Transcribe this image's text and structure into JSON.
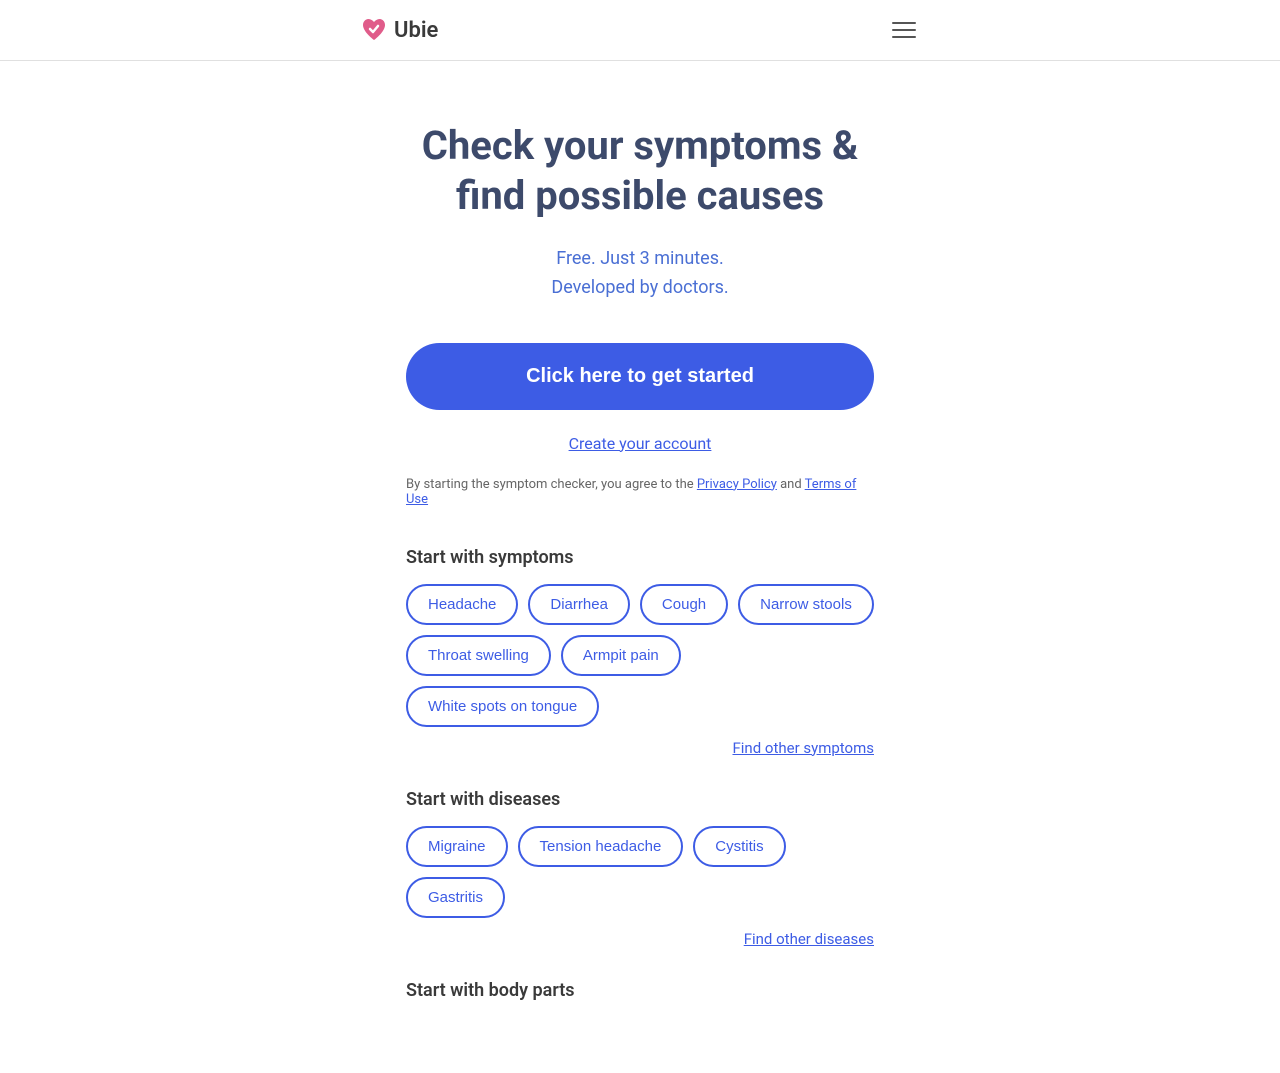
{
  "header": {
    "logo_text": "Ubie",
    "menu_label": "Menu"
  },
  "hero": {
    "title_line1": "Check your symptoms &",
    "title_line2": "find possible causes",
    "subtitle_line1": "Free. Just 3 minutes.",
    "subtitle_line2": "Developed by doctors."
  },
  "cta": {
    "button_label": "Click here to get started",
    "create_account_label": "Create your account",
    "terms_prefix": "By starting the symptom checker, you agree to the ",
    "terms_privacy": "Privacy Policy",
    "terms_and": " and ",
    "terms_tos": "Terms of Use"
  },
  "symptoms_section": {
    "title": "Start with symptoms",
    "tags": [
      "Headache",
      "Diarrhea",
      "Cough",
      "Narrow stools",
      "Throat swelling",
      "Armpit pain",
      "White spots on tongue"
    ],
    "find_more": "Find other symptoms"
  },
  "diseases_section": {
    "title": "Start with diseases",
    "tags": [
      "Migraine",
      "Tension headache",
      "Cystitis",
      "Gastritis"
    ],
    "find_more": "Find other diseases"
  },
  "body_parts_section": {
    "title": "Start with body parts"
  }
}
